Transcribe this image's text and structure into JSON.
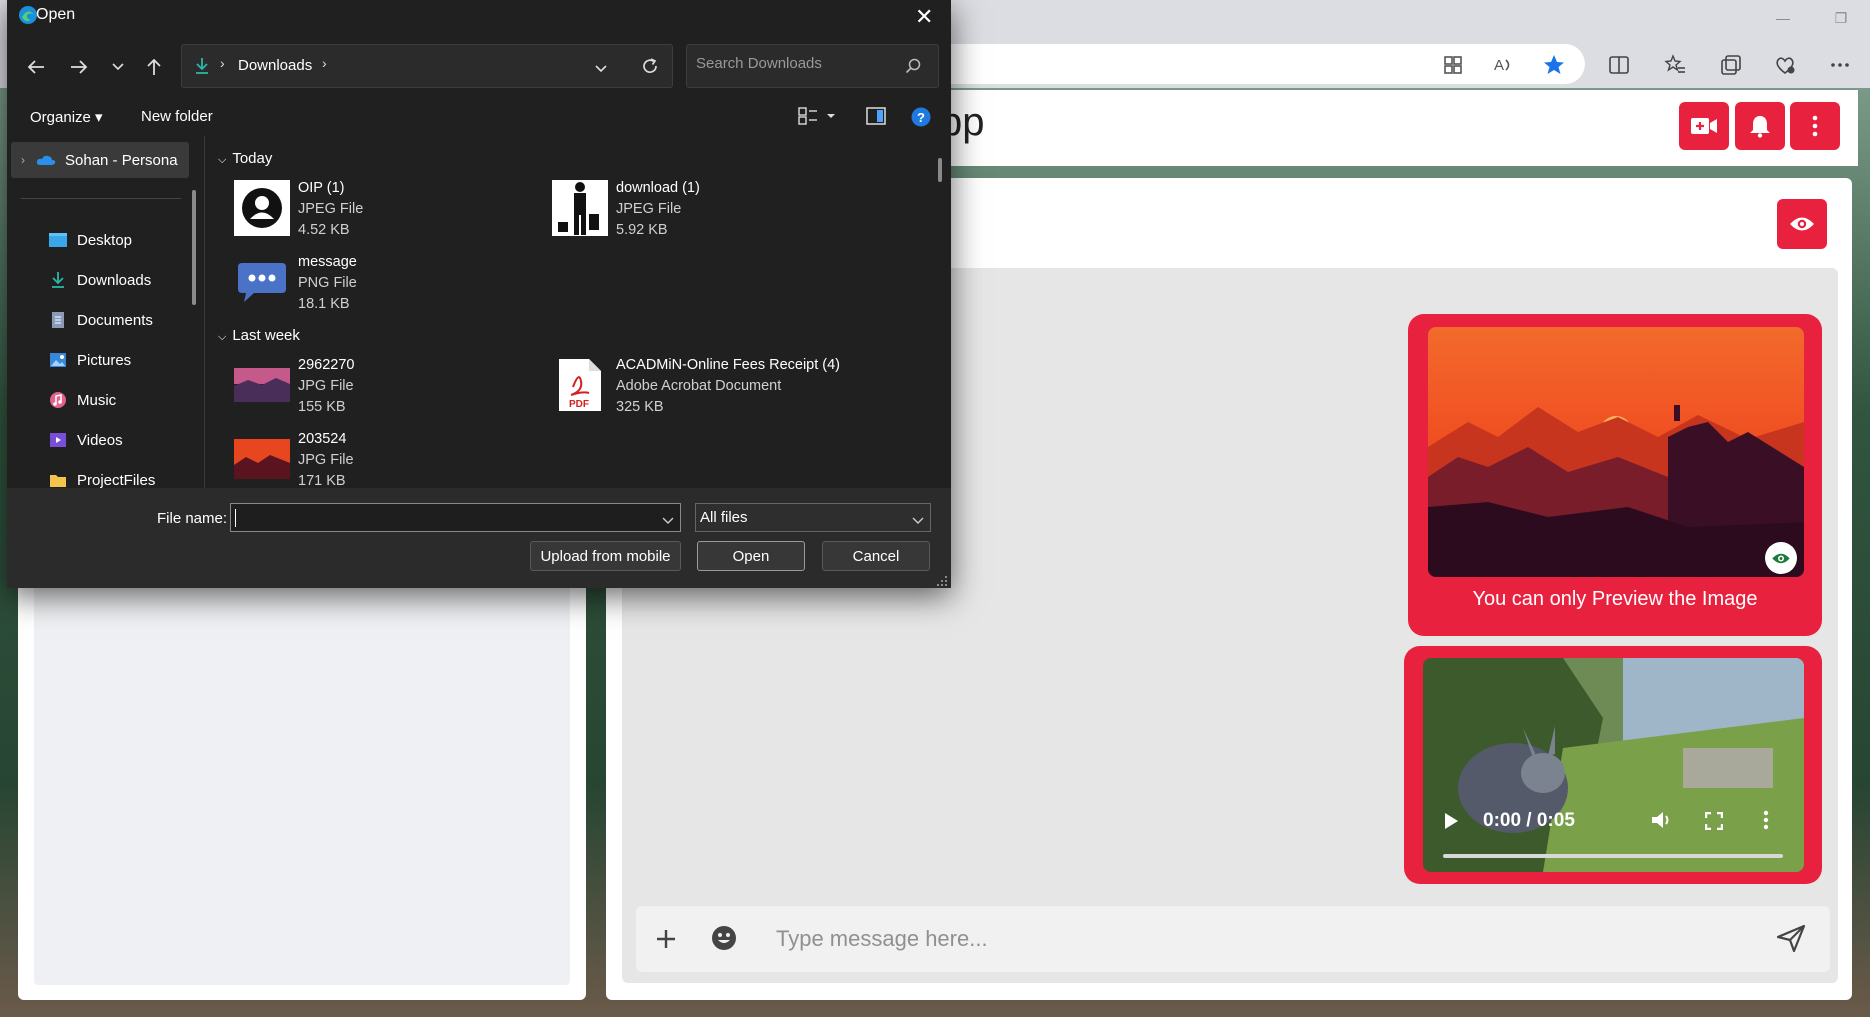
{
  "browser": {
    "window_controls": [
      "—",
      "❐"
    ]
  },
  "app": {
    "title_fragment": "pp"
  },
  "chat": {
    "image_message": {
      "caption": "You can only Preview the Image"
    },
    "video_message": {
      "time": "0:00 / 0:05",
      "progress": 0
    },
    "input": {
      "placeholder": "Type message here..."
    }
  },
  "dialog": {
    "title": "Open",
    "path": {
      "location": "Downloads"
    },
    "search": {
      "placeholder": "Search Downloads"
    },
    "commands": {
      "organize": "Organize ▾",
      "new_folder": "New folder"
    },
    "nav_items": [
      {
        "label": "Sohan - Persona",
        "icon": "cloud-icon"
      },
      {
        "label": "Desktop",
        "icon": "desktop-icon",
        "pinned": true
      },
      {
        "label": "Downloads",
        "icon": "download-icon",
        "pinned": true
      },
      {
        "label": "Documents",
        "icon": "document-icon",
        "pinned": true
      },
      {
        "label": "Pictures",
        "icon": "pictures-icon",
        "pinned": true
      },
      {
        "label": "Music",
        "icon": "music-icon",
        "pinned": true
      },
      {
        "label": "Videos",
        "icon": "videos-icon",
        "pinned": true
      },
      {
        "label": "ProjectFiles",
        "icon": "folder-icon"
      }
    ],
    "groups": {
      "today": "Today",
      "last_week": "Last week"
    },
    "files": [
      {
        "name": "OIP (1)",
        "type": "JPEG File",
        "size": "4.52 KB"
      },
      {
        "name": "download (1)",
        "type": "JPEG File",
        "size": "5.92 KB"
      },
      {
        "name": "message",
        "type": "PNG File",
        "size": "18.1 KB"
      },
      {
        "name": "2962270",
        "type": "JPG File",
        "size": "155 KB"
      },
      {
        "name": "ACADMiN-Online Fees Receipt (4)",
        "type": "Adobe Acrobat Document",
        "size": "325 KB"
      },
      {
        "name": "203524",
        "type": "JPG File",
        "size": "171 KB"
      }
    ],
    "file_name_label": "File name:",
    "file_name_value": "",
    "filter": "All files",
    "buttons": {
      "upload": "Upload from mobile",
      "open": "Open",
      "cancel": "Cancel"
    },
    "pdf_badge": "PDF"
  },
  "colors": {
    "accent": "#e8213f",
    "dialog_bg": "#202020",
    "link_blue": "#1a73e8"
  }
}
